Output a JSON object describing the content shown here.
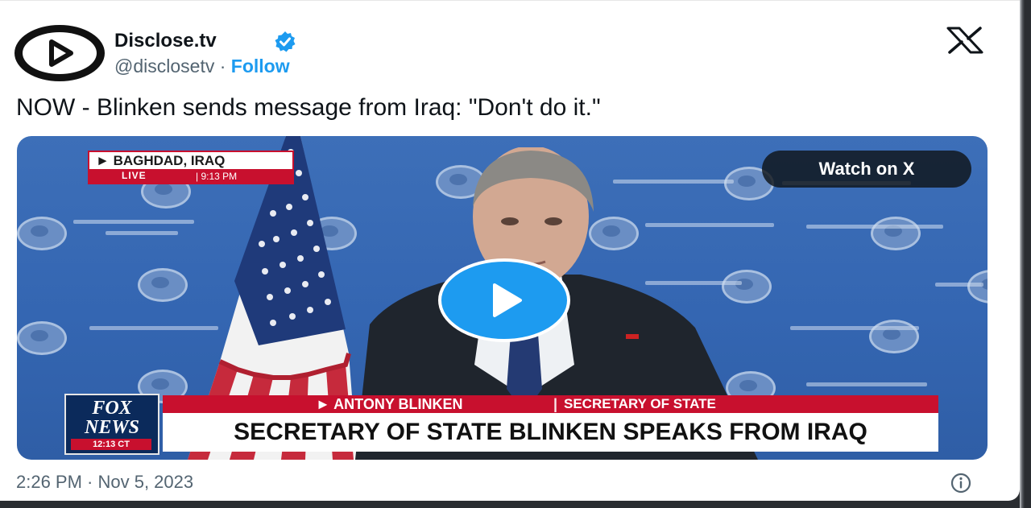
{
  "author": {
    "name": "Disclose.tv",
    "handle": "@disclosetv",
    "separator": "·",
    "follow_label": "Follow"
  },
  "icons": {
    "avatar": "play-logo-icon",
    "verified": "verified-badge-icon",
    "platform": "x-logo-icon",
    "play": "play-icon",
    "info": "info-icon"
  },
  "tweet": {
    "text": "NOW - Blinken sends message from Iraq: \"Don't do it.\"",
    "timestamp": "2:26 PM · Nov 5, 2023"
  },
  "video": {
    "watch_label": "Watch on X",
    "location": "BAGHDAD, IRAQ",
    "live_label": "LIVE",
    "live_time": "9:13 PM",
    "network_name": "FOX NEWS",
    "network_time": "12:13 CT",
    "chyron_name": "ANTONY BLINKEN",
    "chyron_separator": "|",
    "chyron_title": "SECRETARY OF STATE",
    "chyron_headline": "SECRETARY OF STATE BLINKEN SPEAKS FROM IRAQ"
  },
  "colors": {
    "accent": "#1d9bf0",
    "text_primary": "#0f1419",
    "text_secondary": "#536471",
    "fox_red": "#c8102e",
    "fox_blue": "#0b2a5b"
  }
}
